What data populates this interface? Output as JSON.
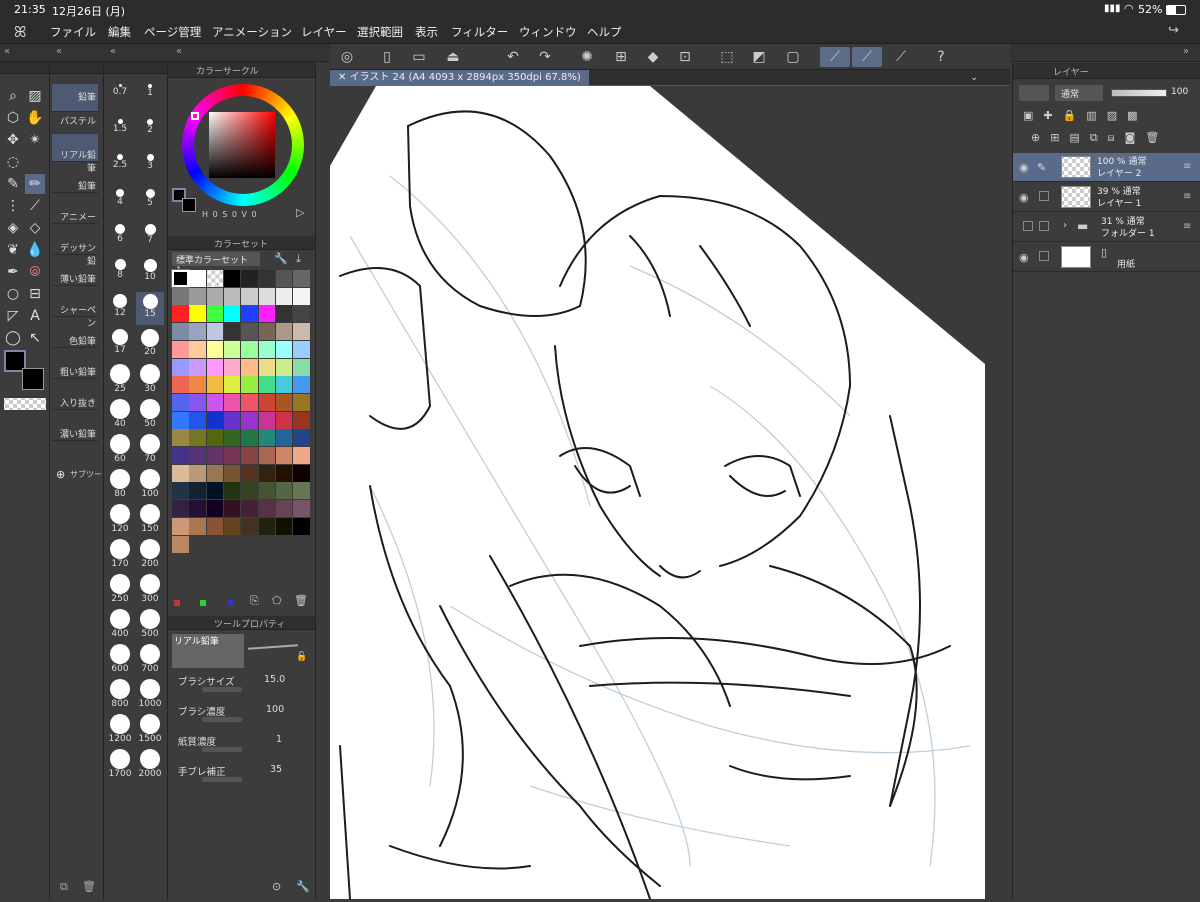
{
  "status": {
    "time": "21:35",
    "date": "12月26日 (月)",
    "battery": "52%"
  },
  "menu": [
    "ファイル",
    "編集",
    "ページ管理",
    "アニメーション",
    "レイヤー",
    "選択範囲",
    "表示",
    "フィルター",
    "ウィンドウ",
    "ヘルプ"
  ],
  "document": {
    "tab_title": "イラスト 24 (A4 4093 x 2894px 350dpi 67.8%)"
  },
  "subtools": [
    "鉛筆",
    "パステル",
    "リアル鉛筆",
    "鉛筆",
    "アニメー",
    "デッサン鉛",
    "薄い鉛筆",
    "シャーペン",
    "色鉛筆",
    "粗い鉛筆",
    "入り抜き",
    "濃い鉛筆"
  ],
  "subtool_add": "サブツー",
  "brush_sizes": [
    "0.7",
    "1",
    "1.5",
    "2",
    "2.5",
    "3",
    "4",
    "5",
    "6",
    "7",
    "8",
    "10",
    "12",
    "15",
    "17",
    "20",
    "25",
    "30",
    "40",
    "50",
    "60",
    "70",
    "80",
    "100",
    "120",
    "150",
    "170",
    "200",
    "250",
    "300",
    "400",
    "500",
    "600",
    "700",
    "800",
    "1000",
    "1200",
    "1500",
    "1700",
    "2000"
  ],
  "color_circle": {
    "title": "カラーサークル",
    "mode_labels": [
      "H",
      "0",
      "S",
      "0",
      "V",
      "0"
    ]
  },
  "color_set": {
    "title": "カラーセット",
    "set_name": "標準カラーセット 1"
  },
  "tool_property": {
    "title": "ツールプロパティ",
    "tool_name": "リアル鉛筆",
    "brush_size_label": "ブラシサイズ",
    "brush_size_value": "15.0",
    "brush_density_label": "ブラシ濃度",
    "brush_density_value": "100",
    "paper_label": "紙質濃度",
    "paper_value": "1",
    "stabilization_label": "手ブレ補正",
    "stabilization_value": "35"
  },
  "layer_panel": {
    "title": "レイヤー",
    "blend_mode": "通常",
    "opacity": "100",
    "layers": [
      {
        "line1": "100 % 通常",
        "line2": "レイヤー 2",
        "selected": true
      },
      {
        "line1": "39 % 通常",
        "line2": "レイヤー 1",
        "selected": false
      },
      {
        "line1": "31 % 通常",
        "line2": "フォルダー 1",
        "selected": false
      },
      {
        "line1": "",
        "line2": "用紙",
        "selected": false
      }
    ]
  },
  "colors": {
    "accent": "#5a6b8a",
    "panel": "#3c3c3c",
    "dark": "#2c2c2c"
  }
}
